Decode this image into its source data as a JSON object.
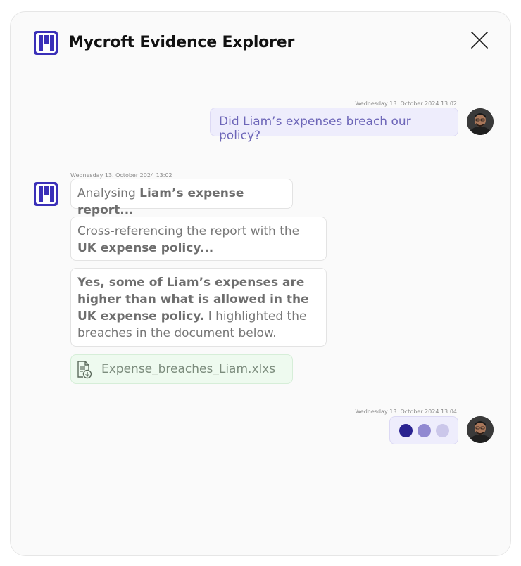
{
  "header": {
    "title": "Mycroft Evidence Explorer"
  },
  "icons": {
    "logo": "mycroft-logo",
    "close": "close-icon",
    "file": "file-download-icon"
  },
  "colors": {
    "brand": "#3a2fb8",
    "user_bubble_bg": "#eeedfc",
    "file_bubble_bg": "#eefaef",
    "typing_dots": [
      "#2a2391",
      "#9189d1",
      "#cbc7ea"
    ]
  },
  "messages": [
    {
      "sender": "user",
      "timestamp": "Wednesday 13. October 2024 13:02",
      "text": "Did Liam’s expenses breach our policy?"
    },
    {
      "sender": "assistant",
      "timestamp": "Wednesday 13. October 2024 13:02",
      "status1": {
        "prefix": "Analysing ",
        "bold": "Liam’s expense report..."
      },
      "status2": {
        "prefix": "Cross-referencing the report with the ",
        "bold": "UK expense policy..."
      },
      "answer": {
        "bold": "Yes, some of Liam’s expenses are higher than what is allowed in the UK expense policy.",
        "rest": " I highlighted the breaches in the document below."
      },
      "attachment": "Expense_breaches_Liam.xlxs"
    },
    {
      "sender": "user",
      "timestamp": "Wednesday 13. October 2024 13:04",
      "typing": true
    }
  ]
}
